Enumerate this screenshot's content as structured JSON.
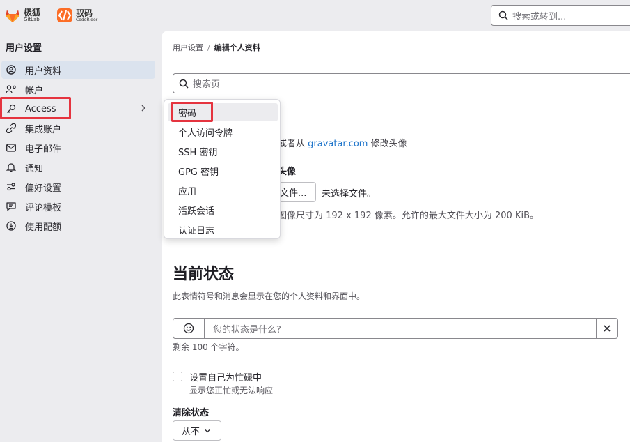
{
  "brand": {
    "gitlab_cn": "极狐",
    "gitlab_en": "GitLab",
    "codemind_cn": "驭码",
    "codemind_en": "CodeRider"
  },
  "topbar": {
    "search_placeholder": "搜索或转到..."
  },
  "sidebar": {
    "title": "用户设置",
    "items": [
      {
        "label": "用户资料",
        "icon": "profile-icon",
        "active": true
      },
      {
        "label": "帐户",
        "icon": "account-icon"
      },
      {
        "label": "Access",
        "icon": "key-icon",
        "has_submenu": true
      },
      {
        "label": "集成账户",
        "icon": "link-icon"
      },
      {
        "label": "电子邮件",
        "icon": "mail-icon"
      },
      {
        "label": "通知",
        "icon": "bell-icon"
      },
      {
        "label": "偏好设置",
        "icon": "preferences-icon"
      },
      {
        "label": "评论模板",
        "icon": "comment-template-icon"
      },
      {
        "label": "使用配额",
        "icon": "quota-icon"
      }
    ]
  },
  "breadcrumb": {
    "parent": "用户设置",
    "separator": "/",
    "current": "编辑个人资料"
  },
  "page_search": {
    "placeholder": "搜索页"
  },
  "avatar": {
    "gravatar_prefix": "或者从 ",
    "gravatar_link": "gravatar.com",
    "gravatar_suffix": " 修改头像",
    "upload_label": "头像",
    "choose_file": "文件...",
    "no_file": "未选择文件。",
    "size_hint": "图像尺寸为 192 x 192 像素。允许的最大文件大小为 200 KiB。"
  },
  "status": {
    "title": "当前状态",
    "description": "此表情符号和消息会显示在您的个人资料和界面中。",
    "placeholder": "您的状态是什么?",
    "remaining": "剩余 100 个字符。",
    "busy_label": "设置自己为忙碌中",
    "busy_help": "显示您正忙或无法响应",
    "clear_label": "清除状态",
    "clear_value": "从不"
  },
  "access_menu": {
    "items": [
      "密码",
      "个人访问令牌",
      "SSH 密钥",
      "GPG 密钥",
      "应用",
      "活跃会话",
      "认证日志"
    ]
  },
  "colors": {
    "accent_link": "#1f75cb",
    "highlight": "#e5343f",
    "active_bg": "#dbe3ee"
  }
}
